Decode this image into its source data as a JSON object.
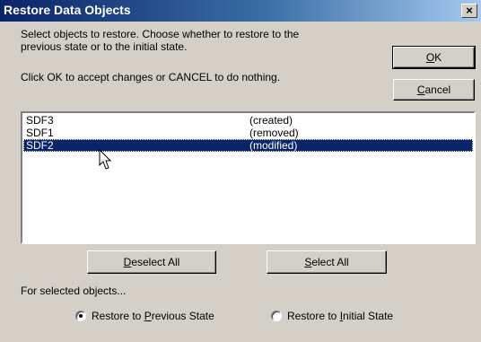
{
  "window": {
    "title": "Restore Data Objects",
    "close_glyph": "×"
  },
  "instructions": {
    "line1": "Select objects to restore. Choose whether to restore to the",
    "line2": "previous state or to the initial state.",
    "line3": "Click OK to accept changes or CANCEL to do nothing."
  },
  "buttons": {
    "ok": {
      "mnemonic": "O",
      "rest": "K"
    },
    "cancel": {
      "mnemonic": "C",
      "rest": "ancel"
    },
    "deselect_all": {
      "mnemonic": "D",
      "rest": "eselect All"
    },
    "select_all": {
      "mnemonic": "S",
      "rest": "elect All"
    }
  },
  "objects": [
    {
      "name": "SDF3",
      "state": "(created)",
      "selected": false
    },
    {
      "name": "SDF1",
      "state": "(removed)",
      "selected": false
    },
    {
      "name": "SDF2",
      "state": "(modified)",
      "selected": true
    }
  ],
  "options": {
    "label": "For selected objects...",
    "previous": {
      "prefix": "Restore to ",
      "mnemonic": "P",
      "rest": "revious State",
      "checked": true
    },
    "initial": {
      "prefix": "Restore to ",
      "mnemonic": "I",
      "rest": "nitial State",
      "checked": false
    }
  },
  "colors": {
    "selection": "#0a246a",
    "face": "#d4d0c8"
  }
}
